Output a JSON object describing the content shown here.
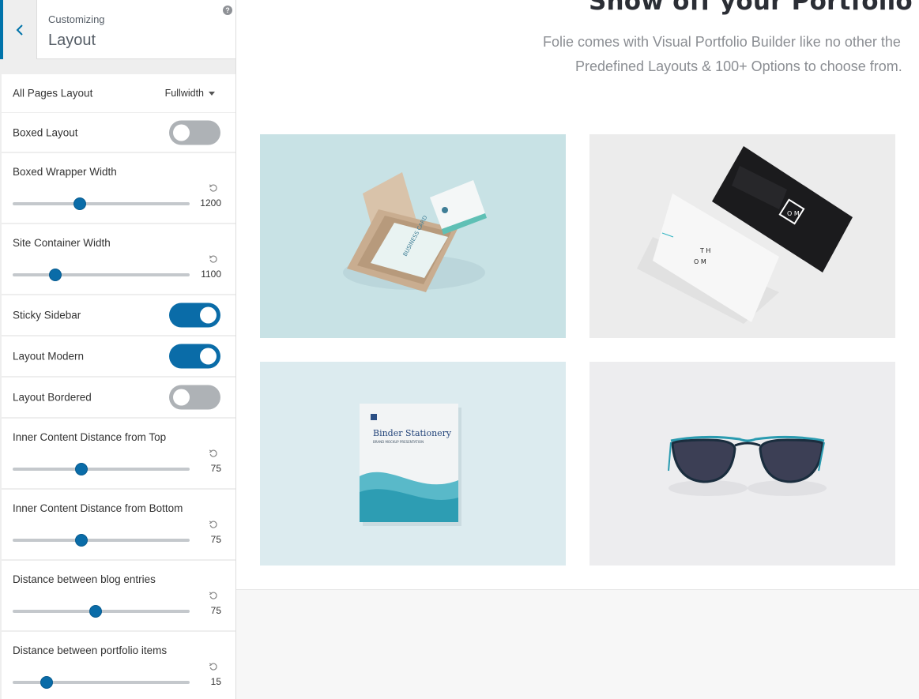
{
  "sidebar": {
    "breadcrumb": "Customizing",
    "title": "Layout",
    "help": "?",
    "controls": {
      "all_pages_layout": {
        "label": "All Pages Layout",
        "value": "Fullwidth"
      },
      "boxed_layout": {
        "label": "Boxed Layout",
        "checked": false
      },
      "boxed_wrapper_width": {
        "label": "Boxed Wrapper Width",
        "value": "1200",
        "fraction": 0.38
      },
      "site_container_width": {
        "label": "Site Container Width",
        "value": "1100",
        "fraction": 0.24
      },
      "sticky_sidebar": {
        "label": "Sticky Sidebar",
        "checked": true
      },
      "layout_modern": {
        "label": "Layout Modern",
        "checked": true
      },
      "layout_bordered": {
        "label": "Layout Bordered",
        "checked": false
      },
      "inner_top": {
        "label": "Inner Content Distance from Top",
        "value": "75",
        "fraction": 0.39
      },
      "inner_bottom": {
        "label": "Inner Content Distance from Bottom",
        "value": "75",
        "fraction": 0.39
      },
      "blog_distance": {
        "label": "Distance between blog entries",
        "value": "75",
        "fraction": 0.47
      },
      "portfolio_distance": {
        "label": "Distance between portfolio items",
        "value": "15",
        "fraction": 0.19
      }
    }
  },
  "preview": {
    "heading": "Show off your Portfolio",
    "line1": "Folie comes with Visual Portfolio Builder like no other the",
    "line2": "Predefined Layouts & 100+ Options to choose from.",
    "tiles": {
      "binder_title": "Binder Stationery",
      "binder_subtitle": "BRAND MOCKUP PRESENTATION",
      "card_box_text": "BUSINESS CARD"
    }
  },
  "colors": {
    "accent": "#0a6ca8",
    "toggle_off": "#aeb2b6",
    "panel_bg": "#eeeeee"
  }
}
